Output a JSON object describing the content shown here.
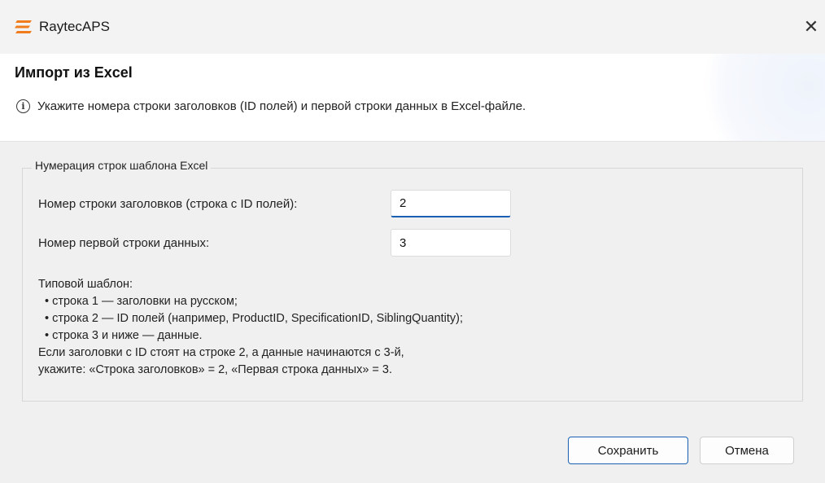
{
  "window": {
    "app_title": "RaytecAPS",
    "close_glyph": "✕",
    "brand_color": "#f07c1e"
  },
  "header": {
    "title": "Импорт из Excel",
    "info_glyph": "i",
    "description": "Укажите номера строки заголовков (ID полей) и первой строки данных в Excel-файле."
  },
  "group": {
    "legend": "Нумерация строк шаблона Excel",
    "header_row": {
      "label": "Номер строки заголовков (строка с ID полей):",
      "value": "2"
    },
    "data_row": {
      "label": "Номер первой строки данных:",
      "value": "3"
    },
    "help": {
      "intro": "Типовой шаблон:",
      "items": [
        "• строка 1 — заголовки на русском;",
        "• строка 2 — ID полей (например, ProductID, SpecificationID, SiblingQuantity);",
        "• строка 3 и ниже — данные."
      ],
      "note_line1": "Если заголовки с ID стоят на строке 2, а данные начинаются с 3-й,",
      "note_line2": "укажите: «Строка заголовков» = 2, «Первая строка данных» = 3."
    }
  },
  "buttons": {
    "save": "Сохранить",
    "cancel": "Отмена",
    "accent": "#1a5fb4"
  }
}
